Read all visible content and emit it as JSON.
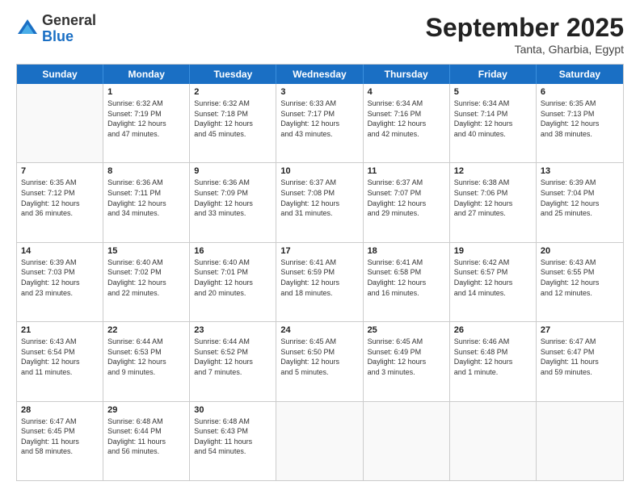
{
  "header": {
    "logo_general": "General",
    "logo_blue": "Blue",
    "month": "September 2025",
    "location": "Tanta, Gharbia, Egypt"
  },
  "weekdays": [
    "Sunday",
    "Monday",
    "Tuesday",
    "Wednesday",
    "Thursday",
    "Friday",
    "Saturday"
  ],
  "weeks": [
    [
      {
        "day": "",
        "info": ""
      },
      {
        "day": "1",
        "info": "Sunrise: 6:32 AM\nSunset: 7:19 PM\nDaylight: 12 hours\nand 47 minutes."
      },
      {
        "day": "2",
        "info": "Sunrise: 6:32 AM\nSunset: 7:18 PM\nDaylight: 12 hours\nand 45 minutes."
      },
      {
        "day": "3",
        "info": "Sunrise: 6:33 AM\nSunset: 7:17 PM\nDaylight: 12 hours\nand 43 minutes."
      },
      {
        "day": "4",
        "info": "Sunrise: 6:34 AM\nSunset: 7:16 PM\nDaylight: 12 hours\nand 42 minutes."
      },
      {
        "day": "5",
        "info": "Sunrise: 6:34 AM\nSunset: 7:14 PM\nDaylight: 12 hours\nand 40 minutes."
      },
      {
        "day": "6",
        "info": "Sunrise: 6:35 AM\nSunset: 7:13 PM\nDaylight: 12 hours\nand 38 minutes."
      }
    ],
    [
      {
        "day": "7",
        "info": "Sunrise: 6:35 AM\nSunset: 7:12 PM\nDaylight: 12 hours\nand 36 minutes."
      },
      {
        "day": "8",
        "info": "Sunrise: 6:36 AM\nSunset: 7:11 PM\nDaylight: 12 hours\nand 34 minutes."
      },
      {
        "day": "9",
        "info": "Sunrise: 6:36 AM\nSunset: 7:09 PM\nDaylight: 12 hours\nand 33 minutes."
      },
      {
        "day": "10",
        "info": "Sunrise: 6:37 AM\nSunset: 7:08 PM\nDaylight: 12 hours\nand 31 minutes."
      },
      {
        "day": "11",
        "info": "Sunrise: 6:37 AM\nSunset: 7:07 PM\nDaylight: 12 hours\nand 29 minutes."
      },
      {
        "day": "12",
        "info": "Sunrise: 6:38 AM\nSunset: 7:06 PM\nDaylight: 12 hours\nand 27 minutes."
      },
      {
        "day": "13",
        "info": "Sunrise: 6:39 AM\nSunset: 7:04 PM\nDaylight: 12 hours\nand 25 minutes."
      }
    ],
    [
      {
        "day": "14",
        "info": "Sunrise: 6:39 AM\nSunset: 7:03 PM\nDaylight: 12 hours\nand 23 minutes."
      },
      {
        "day": "15",
        "info": "Sunrise: 6:40 AM\nSunset: 7:02 PM\nDaylight: 12 hours\nand 22 minutes."
      },
      {
        "day": "16",
        "info": "Sunrise: 6:40 AM\nSunset: 7:01 PM\nDaylight: 12 hours\nand 20 minutes."
      },
      {
        "day": "17",
        "info": "Sunrise: 6:41 AM\nSunset: 6:59 PM\nDaylight: 12 hours\nand 18 minutes."
      },
      {
        "day": "18",
        "info": "Sunrise: 6:41 AM\nSunset: 6:58 PM\nDaylight: 12 hours\nand 16 minutes."
      },
      {
        "day": "19",
        "info": "Sunrise: 6:42 AM\nSunset: 6:57 PM\nDaylight: 12 hours\nand 14 minutes."
      },
      {
        "day": "20",
        "info": "Sunrise: 6:43 AM\nSunset: 6:55 PM\nDaylight: 12 hours\nand 12 minutes."
      }
    ],
    [
      {
        "day": "21",
        "info": "Sunrise: 6:43 AM\nSunset: 6:54 PM\nDaylight: 12 hours\nand 11 minutes."
      },
      {
        "day": "22",
        "info": "Sunrise: 6:44 AM\nSunset: 6:53 PM\nDaylight: 12 hours\nand 9 minutes."
      },
      {
        "day": "23",
        "info": "Sunrise: 6:44 AM\nSunset: 6:52 PM\nDaylight: 12 hours\nand 7 minutes."
      },
      {
        "day": "24",
        "info": "Sunrise: 6:45 AM\nSunset: 6:50 PM\nDaylight: 12 hours\nand 5 minutes."
      },
      {
        "day": "25",
        "info": "Sunrise: 6:45 AM\nSunset: 6:49 PM\nDaylight: 12 hours\nand 3 minutes."
      },
      {
        "day": "26",
        "info": "Sunrise: 6:46 AM\nSunset: 6:48 PM\nDaylight: 12 hours\nand 1 minute."
      },
      {
        "day": "27",
        "info": "Sunrise: 6:47 AM\nSunset: 6:47 PM\nDaylight: 11 hours\nand 59 minutes."
      }
    ],
    [
      {
        "day": "28",
        "info": "Sunrise: 6:47 AM\nSunset: 6:45 PM\nDaylight: 11 hours\nand 58 minutes."
      },
      {
        "day": "29",
        "info": "Sunrise: 6:48 AM\nSunset: 6:44 PM\nDaylight: 11 hours\nand 56 minutes."
      },
      {
        "day": "30",
        "info": "Sunrise: 6:48 AM\nSunset: 6:43 PM\nDaylight: 11 hours\nand 54 minutes."
      },
      {
        "day": "",
        "info": ""
      },
      {
        "day": "",
        "info": ""
      },
      {
        "day": "",
        "info": ""
      },
      {
        "day": "",
        "info": ""
      }
    ]
  ]
}
